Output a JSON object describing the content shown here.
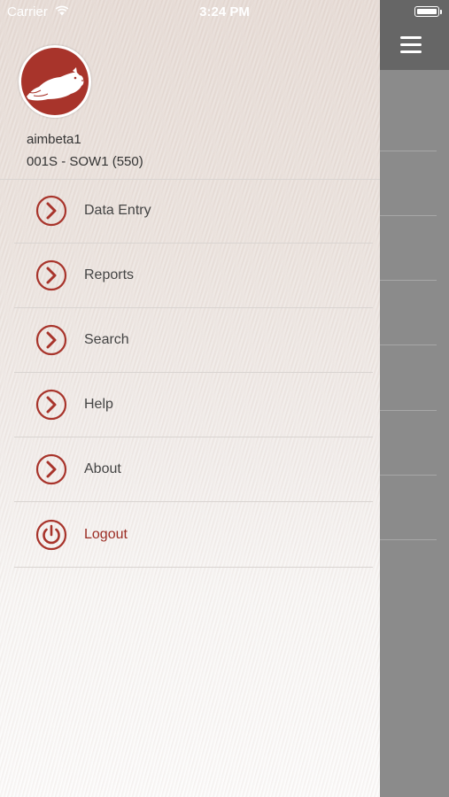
{
  "status_bar": {
    "carrier": "Carrier",
    "time": "3:24 PM"
  },
  "profile": {
    "username": "aimbeta1",
    "farm": "001S - SOW1 (550)"
  },
  "menu": {
    "items": [
      {
        "label": "Data Entry",
        "icon": "chevron-right-circle-icon"
      },
      {
        "label": "Reports",
        "icon": "chevron-right-circle-icon"
      },
      {
        "label": "Search",
        "icon": "chevron-right-circle-icon"
      },
      {
        "label": "Help",
        "icon": "chevron-right-circle-icon"
      },
      {
        "label": "About",
        "icon": "chevron-right-circle-icon"
      },
      {
        "label": "Logout",
        "icon": "power-icon"
      }
    ]
  },
  "colors": {
    "accent": "#a8342b",
    "header_gray": "#666666",
    "panel_gray": "#8b8b8b"
  }
}
